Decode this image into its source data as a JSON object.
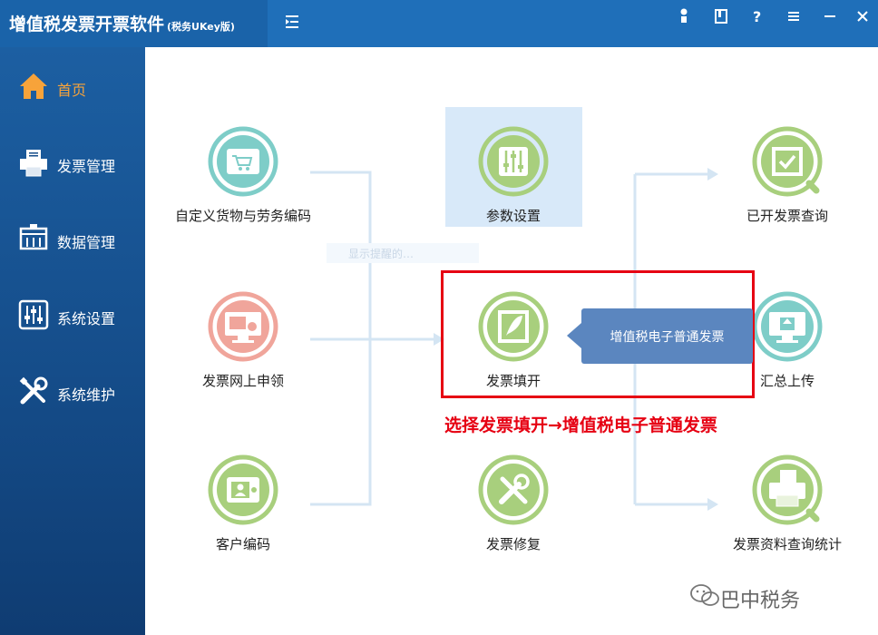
{
  "app": {
    "title": "增值税发票开票软件",
    "subtitle": "(税务UKey版)"
  },
  "titlebar_icons": [
    "user-icon",
    "book-icon",
    "help-icon",
    "menu-icon",
    "minimize-icon",
    "close-icon"
  ],
  "sidebar": {
    "items": [
      {
        "label": "首页",
        "icon": "home-icon",
        "active": true
      },
      {
        "label": "发票管理",
        "icon": "printer-icon",
        "active": false
      },
      {
        "label": "数据管理",
        "icon": "data-icon",
        "active": false
      },
      {
        "label": "系统设置",
        "icon": "sliders-icon",
        "active": false
      },
      {
        "label": "系统维护",
        "icon": "tools-icon",
        "active": false
      }
    ]
  },
  "functions": {
    "custom_goods": {
      "label": "自定义货物与劳务编码",
      "icon": "wallet-cart-icon"
    },
    "invoice_apply": {
      "label": "发票网上申领",
      "icon": "monitor-invoice-icon"
    },
    "customer_code": {
      "label": "客户编码",
      "icon": "wallet-person-icon"
    },
    "params": {
      "label": "参数设置",
      "icon": "sliders-icon"
    },
    "invoice_fill": {
      "label": "发票填开",
      "icon": "feather-film-icon"
    },
    "invoice_repair": {
      "label": "发票修复",
      "icon": "tools-icon"
    },
    "issued_query": {
      "label": "已开发票查询",
      "icon": "film-check-icon"
    },
    "summary_upload": {
      "label": "汇总上传",
      "icon": "monitor-upload-icon"
    },
    "data_stats": {
      "label": "发票资料查询统计",
      "icon": "printer-magnifier-icon"
    }
  },
  "tooltip": {
    "label": "增值税电子普通发票"
  },
  "ghost_text": "显示提醒的…",
  "instruction": "选择发票填开→增值税电子普通发票",
  "watermark": "巴中税务",
  "colors": {
    "titlebar": "#1f6fb9",
    "sidebar": "#154d8a",
    "active_nav": "#f7a33a",
    "teal_icon": "#7ecdc8",
    "green_icon": "#a8cf7d",
    "pink_icon": "#f0a59b",
    "flow_line": "#d4e5f3",
    "highlight_red": "#e60012"
  }
}
